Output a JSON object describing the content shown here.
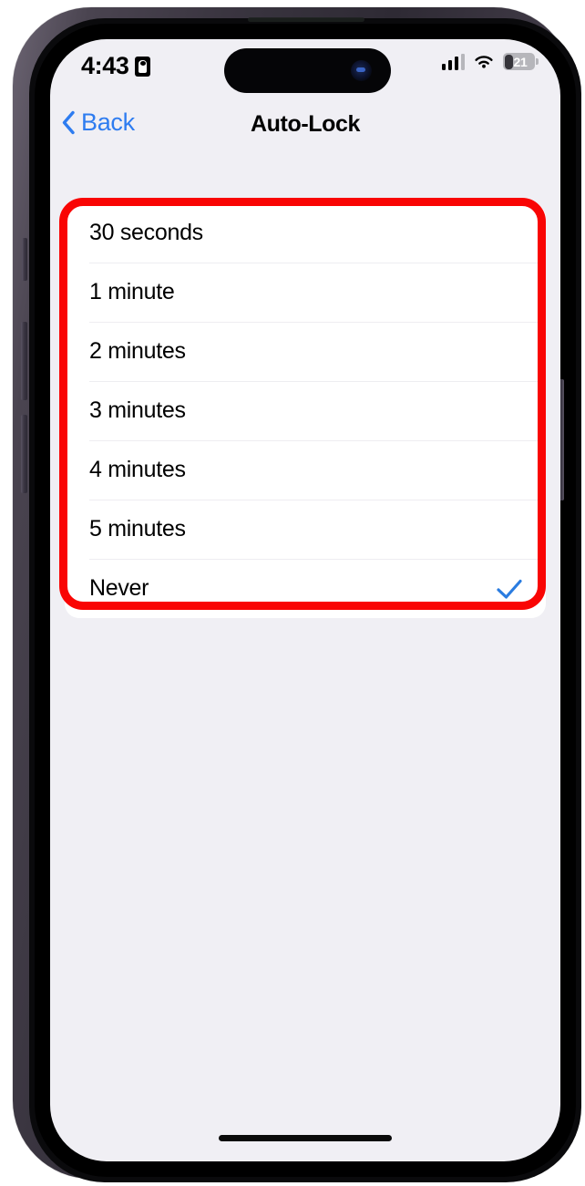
{
  "device": {
    "name": "iPhone 14 Pro",
    "frame_color": "#3a3540",
    "screen_background": "#f0eff4",
    "hardware_buttons": [
      {
        "name": "silent-switch"
      },
      {
        "name": "volume-up-button"
      },
      {
        "name": "volume-down-button"
      },
      {
        "name": "power-button"
      }
    ],
    "dynamic_island": {
      "camera_icon": "front-camera-icon"
    },
    "speaker_grille": "earpiece-speaker",
    "home_indicator": "home-indicator"
  },
  "status_bar": {
    "time": "4:43",
    "recording_icon": "screen-recording-badge-icon",
    "cellular_icon": "cellular-signal-icon",
    "wifi_icon": "wifi-icon",
    "battery": {
      "icon": "battery-icon",
      "percent_label": "21",
      "percent_value": 21
    }
  },
  "nav_bar": {
    "back_icon": "chevron-left-icon",
    "back_label": "Back",
    "title": "Auto-Lock"
  },
  "auto_lock": {
    "selected_value": "Never",
    "checkmark_icon": "checkmark-icon",
    "checkmark_color": "#2a7ce0",
    "options": [
      {
        "label": "30 seconds",
        "selected": false
      },
      {
        "label": "1 minute",
        "selected": false
      },
      {
        "label": "2 minutes",
        "selected": false
      },
      {
        "label": "3 minutes",
        "selected": false
      },
      {
        "label": "4 minutes",
        "selected": false
      },
      {
        "label": "5 minutes",
        "selected": false
      },
      {
        "label": "Never",
        "selected": true
      }
    ]
  },
  "annotation": {
    "type": "red-highlight-rectangle",
    "color": "#f90504",
    "target": "auto-lock-options-list"
  }
}
